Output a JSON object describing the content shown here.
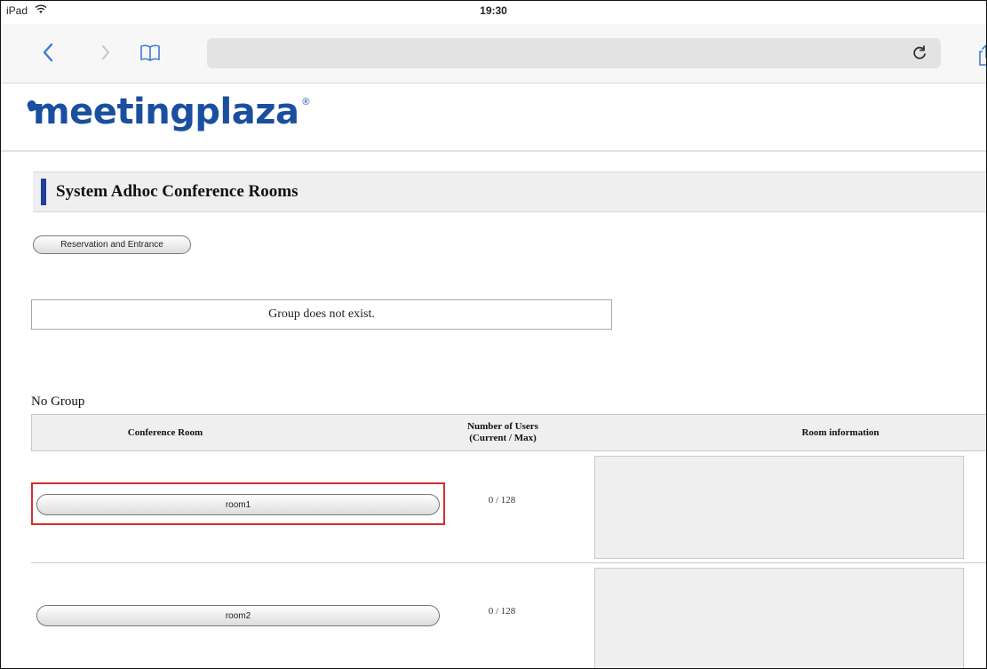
{
  "status_bar": {
    "device": "iPad",
    "time": "19:30"
  },
  "browser": {
    "address_value": ""
  },
  "logo": {
    "text": "meetingplaza",
    "reg": "®"
  },
  "page": {
    "section_title": "System Adhoc Conference Rooms",
    "reservation_button": "Reservation and Entrance",
    "group_message": "Group does not exist.",
    "group_label": "No Group"
  },
  "table": {
    "headers": {
      "room": "Conference Room",
      "users_line1": "Number of Users",
      "users_line2": "(Current / Max)",
      "info": "Room information"
    },
    "rows": [
      {
        "room": "room1",
        "users": "0 / 128",
        "info": ""
      },
      {
        "room": "room2",
        "users": "0 / 128",
        "info": ""
      }
    ]
  },
  "colors": {
    "brand": "#1a4fa0",
    "section_bar": "#1f3f9a",
    "ios_blue": "#3a7bd5",
    "highlight": "#d82c2c"
  },
  "icons": [
    "wifi-icon",
    "back-chevron-icon",
    "forward-chevron-icon",
    "bookmarks-book-icon",
    "reload-icon",
    "share-icon"
  ]
}
